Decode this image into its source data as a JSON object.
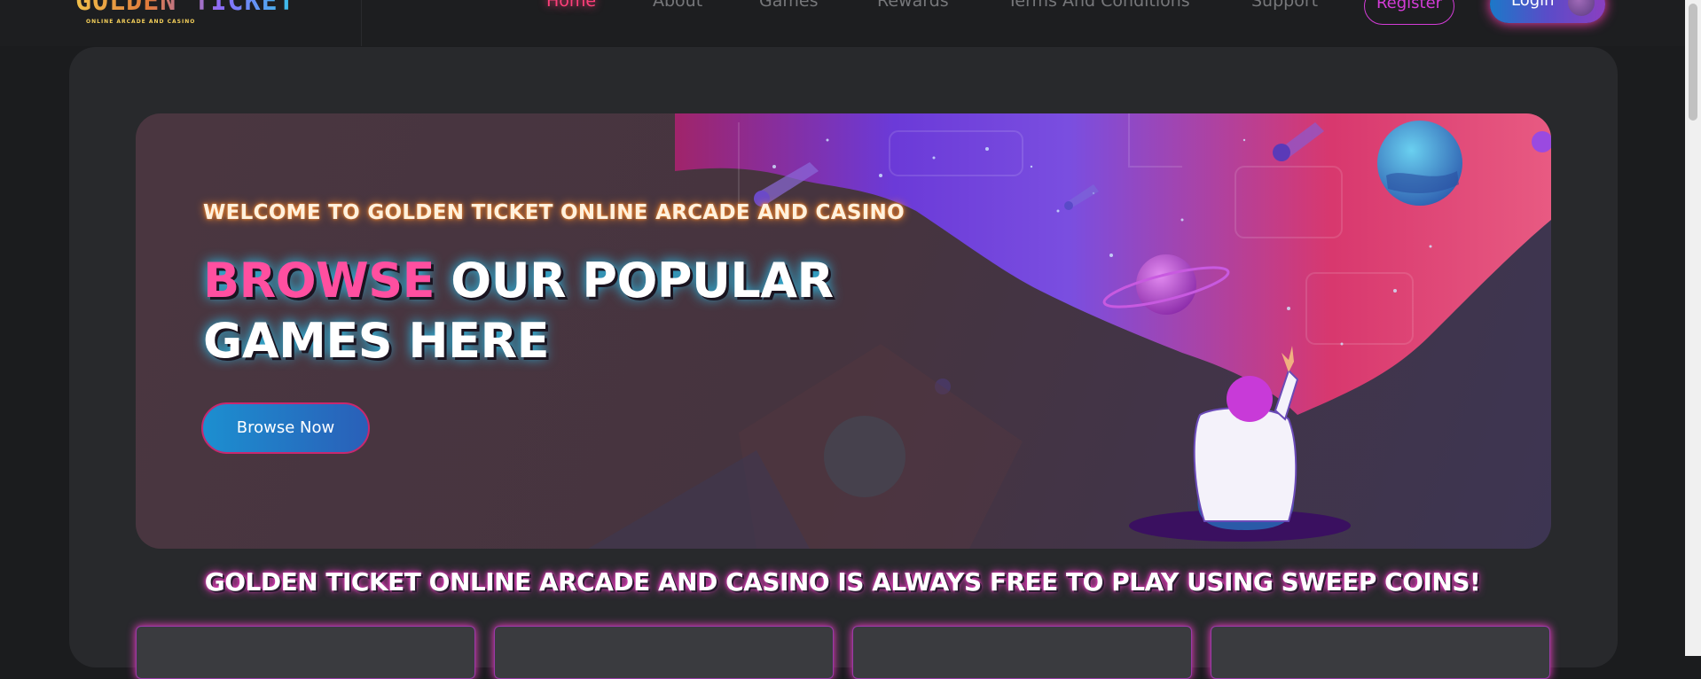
{
  "brand": {
    "logo_text": "GOLDEN TICKET",
    "logo_subtext": "ONLINE ARCADE AND CASINO"
  },
  "nav": {
    "items": [
      {
        "label": "Home",
        "active": true
      },
      {
        "label": "About"
      },
      {
        "label": "Games"
      },
      {
        "label": "Rewards"
      },
      {
        "label": "Terms And Conditions"
      },
      {
        "label": "Support"
      }
    ],
    "register_label": "Register",
    "login_label": "Login"
  },
  "hero": {
    "welcome": "WELCOME TO GOLDEN TICKET ONLINE ARCADE AND CASINO",
    "headline_accent": "BROWSE",
    "headline_rest": " OUR POPULAR GAMES HERE",
    "button_label": "Browse Now"
  },
  "tagline": "GOLDEN TICKET ONLINE ARCADE AND CASINO IS ALWAYS FREE TO PLAY USING SWEEP COINS!",
  "colors": {
    "accent_pink": "#ff3f7a",
    "neon_magenta": "#ff3fd0",
    "background": "#1b1c1e",
    "card": "#28292c"
  },
  "icons": [
    "planet-icon",
    "comet-icon",
    "astronaut-illustration",
    "avatar"
  ]
}
